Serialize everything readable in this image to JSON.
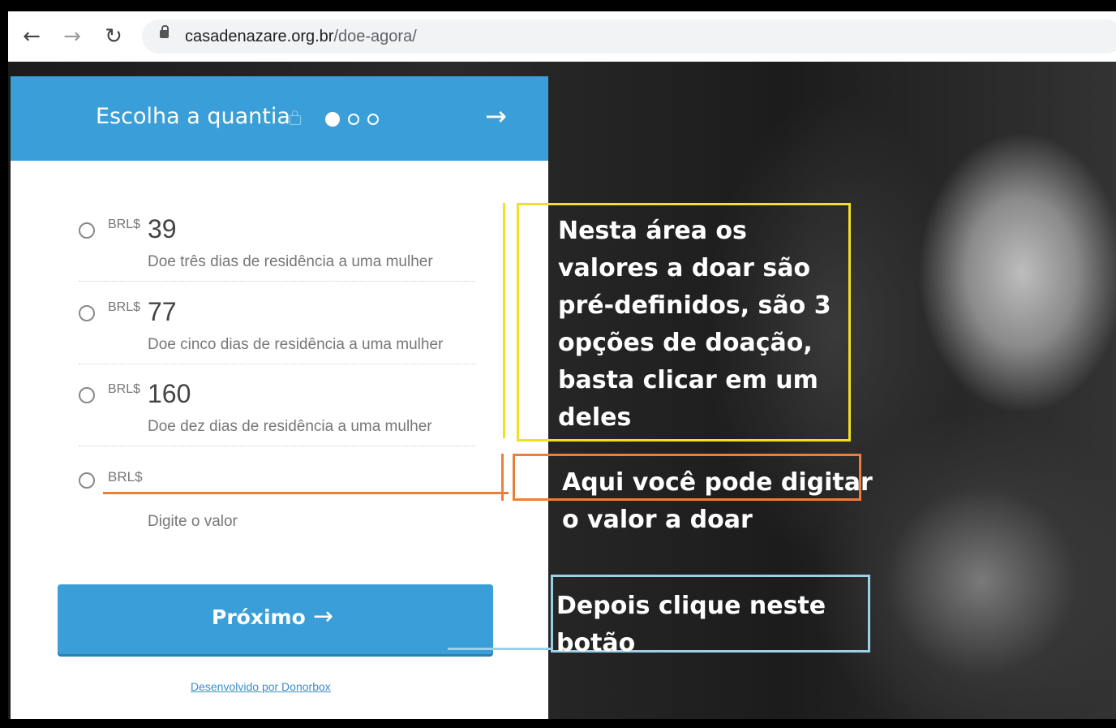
{
  "browser": {
    "url_host": "casadenazare.org.br",
    "url_path": "/doe-agora/"
  },
  "widget": {
    "title": "Escolha a quantia",
    "options": [
      {
        "currency": "BRL$",
        "amount": "39",
        "description": "Doe três dias de residência a uma mulher"
      },
      {
        "currency": "BRL$",
        "amount": "77",
        "description": "Doe cinco dias de residência a uma mulher"
      },
      {
        "currency": "BRL$",
        "amount": "160",
        "description": "Doe dez dias de residência a uma mulher"
      }
    ],
    "custom": {
      "currency": "BRL$",
      "hint": "Digite o valor"
    },
    "next_label": "Próximo",
    "powered_by": "Desenvolvido por Donorbox",
    "accent_color": "#3a9fd8"
  },
  "annotations": {
    "predefined": "Nesta área os valores a doar são pré-definidos, são 3 opções de doação, basta clicar em um deles",
    "custom": "Aqui você pode digitar o valor a doar",
    "button": "Depois clique neste botão",
    "colors": {
      "predefined": "#f0e020",
      "custom": "#e9803a",
      "button": "#9ad0e8"
    }
  }
}
